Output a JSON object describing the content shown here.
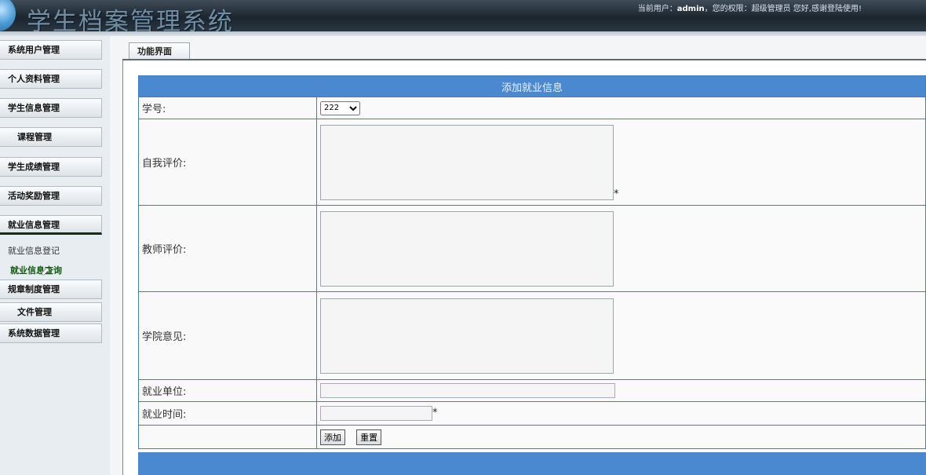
{
  "header": {
    "app_title": "学生档案管理系统",
    "userbar_prefix": "当前用户：",
    "user": "admin",
    "userbar_suffix": "，您的权限：超级管理员  您好,感谢登陆使用!"
  },
  "sidebar": {
    "items": [
      {
        "label": "系统用户管理"
      },
      {
        "label": "个人资料管理"
      },
      {
        "label": "学生信息管理"
      },
      {
        "label": "课程管理"
      },
      {
        "label": "学生成绩管理"
      },
      {
        "label": "活动奖励管理"
      },
      {
        "label": "就业信息管理"
      },
      {
        "label": "规章制度管理"
      },
      {
        "label": "文件管理"
      },
      {
        "label": "系统数据管理"
      }
    ],
    "submenu": [
      {
        "label": "就业信息登记"
      },
      {
        "label": "就业信息查询"
      }
    ]
  },
  "main": {
    "tab_label": "功能界面"
  },
  "form": {
    "title": "添加就业信息",
    "student_id_label": "学号:",
    "student_id_value": "222",
    "self_eval_label": "自我评价:",
    "teacher_eval_label": "教师评价:",
    "college_opinion_label": "学院意见:",
    "employer_label": "就业单位:",
    "employ_time_label": "就业时间:",
    "required_mark": "*",
    "submit_label": "添加",
    "reset_label": "重置"
  },
  "colors": {
    "header_bg": "#1b252e",
    "form_header": "#4a88cf",
    "table_border": "#3a7fc7",
    "active_submenu": "#0e5a0e"
  }
}
